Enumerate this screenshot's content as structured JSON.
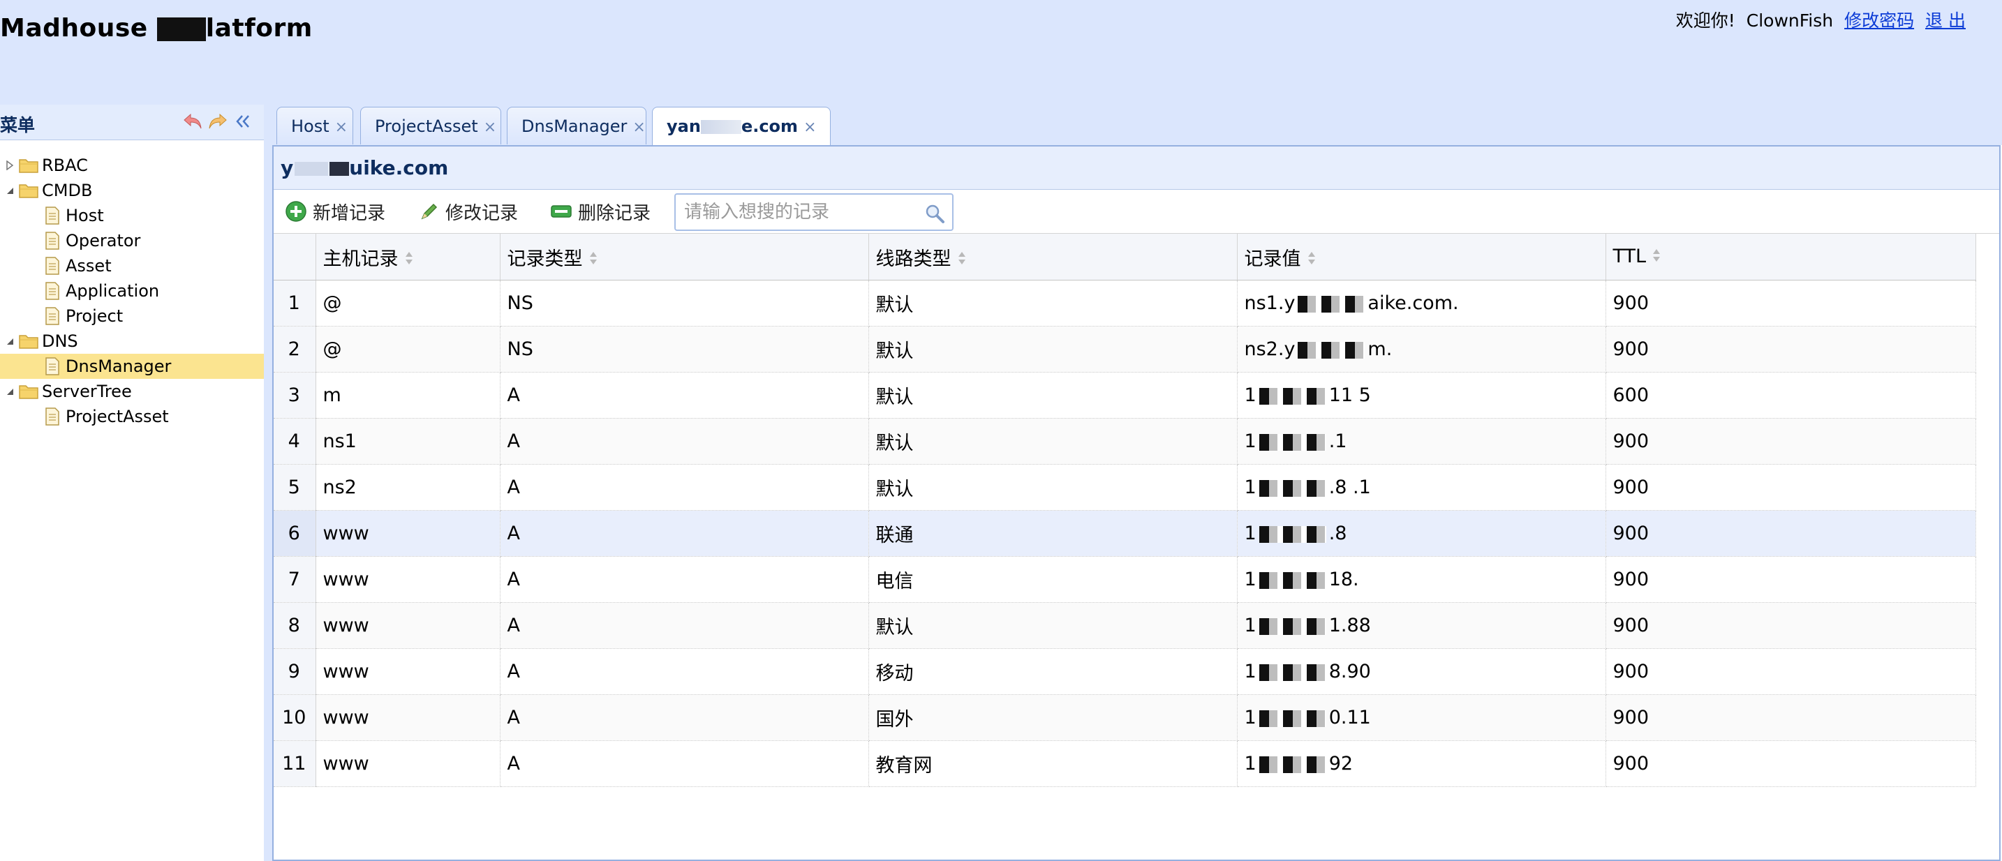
{
  "header": {
    "title_start": "Madhouse ",
    "title_end": "latform",
    "welcome": "欢迎你!",
    "username": "ClownFish",
    "change_password": "修改密码",
    "logout": "退 出"
  },
  "sidebar": {
    "title": "菜单",
    "tree": [
      {
        "label": "RBAC",
        "level": 0,
        "type": "folder",
        "expanded": false
      },
      {
        "label": "CMDB",
        "level": 0,
        "type": "folder",
        "expanded": true
      },
      {
        "label": "Host",
        "level": 1,
        "type": "file"
      },
      {
        "label": "Operator",
        "level": 1,
        "type": "file"
      },
      {
        "label": "Asset",
        "level": 1,
        "type": "file"
      },
      {
        "label": "Application",
        "level": 1,
        "type": "file"
      },
      {
        "label": "Project",
        "level": 1,
        "type": "file"
      },
      {
        "label": "DNS",
        "level": 0,
        "type": "folder",
        "expanded": true
      },
      {
        "label": "DnsManager",
        "level": 1,
        "type": "file",
        "selected": true
      },
      {
        "label": "ServerTree",
        "level": 0,
        "type": "folder",
        "expanded": true
      },
      {
        "label": "ProjectAsset",
        "level": 1,
        "type": "file"
      }
    ]
  },
  "tabs": [
    {
      "label": "Host",
      "active": false
    },
    {
      "label": "ProjectAsset",
      "active": false
    },
    {
      "label": "DnsManager",
      "active": false
    },
    {
      "label": "e.com",
      "prefix": "yan",
      "active": true
    }
  ],
  "content": {
    "title_prefix": "y",
    "title_suffix": "uike.com",
    "toolbar": {
      "add_label": "新增记录",
      "edit_label": "修改记录",
      "delete_label": "删除记录",
      "search_placeholder": "请输入想搜的记录"
    },
    "columns": [
      "主机记录",
      "记录类型",
      "线路类型",
      "记录值",
      "TTL"
    ],
    "rows": [
      {
        "n": "1",
        "host": "@",
        "type": "NS",
        "line": "默认",
        "value": "ns1.y",
        "value_tail": "aike.com.",
        "ttl": "900"
      },
      {
        "n": "2",
        "host": "@",
        "type": "NS",
        "line": "默认",
        "value": "ns2.y",
        "value_tail": "m.",
        "ttl": "900"
      },
      {
        "n": "3",
        "host": "m",
        "type": "A",
        "line": "默认",
        "value": "1",
        "value_tail": "11 5",
        "ttl": "600"
      },
      {
        "n": "4",
        "host": "ns1",
        "type": "A",
        "line": "默认",
        "value": "1",
        "value_tail": ".1",
        "ttl": "900"
      },
      {
        "n": "5",
        "host": "ns2",
        "type": "A",
        "line": "默认",
        "value": "1",
        "value_tail": ".8  .1",
        "ttl": "900"
      },
      {
        "n": "6",
        "host": "www",
        "type": "A",
        "line": "联通",
        "value": "1",
        "value_tail": ".8",
        "ttl": "900"
      },
      {
        "n": "7",
        "host": "www",
        "type": "A",
        "line": "电信",
        "value": "1",
        "value_tail": "18.",
        "ttl": "900"
      },
      {
        "n": "8",
        "host": "www",
        "type": "A",
        "line": "默认",
        "value": "1",
        "value_tail": "1.88",
        "ttl": "900"
      },
      {
        "n": "9",
        "host": "www",
        "type": "A",
        "line": "移动",
        "value": "1",
        "value_tail": "8.90",
        "ttl": "900"
      },
      {
        "n": "10",
        "host": "www",
        "type": "A",
        "line": "国外",
        "value": "1",
        "value_tail": "0.11",
        "ttl": "900"
      },
      {
        "n": "11",
        "host": "www",
        "type": "A",
        "line": "教育网",
        "value": "1",
        "value_tail": "92",
        "ttl": "900"
      }
    ]
  },
  "colors": {
    "header_bg": "#dbe6fd",
    "selected_tree_bg": "#fbe490",
    "highlight_row_bg": "#e8eefc",
    "link": "#0b3bd6"
  }
}
